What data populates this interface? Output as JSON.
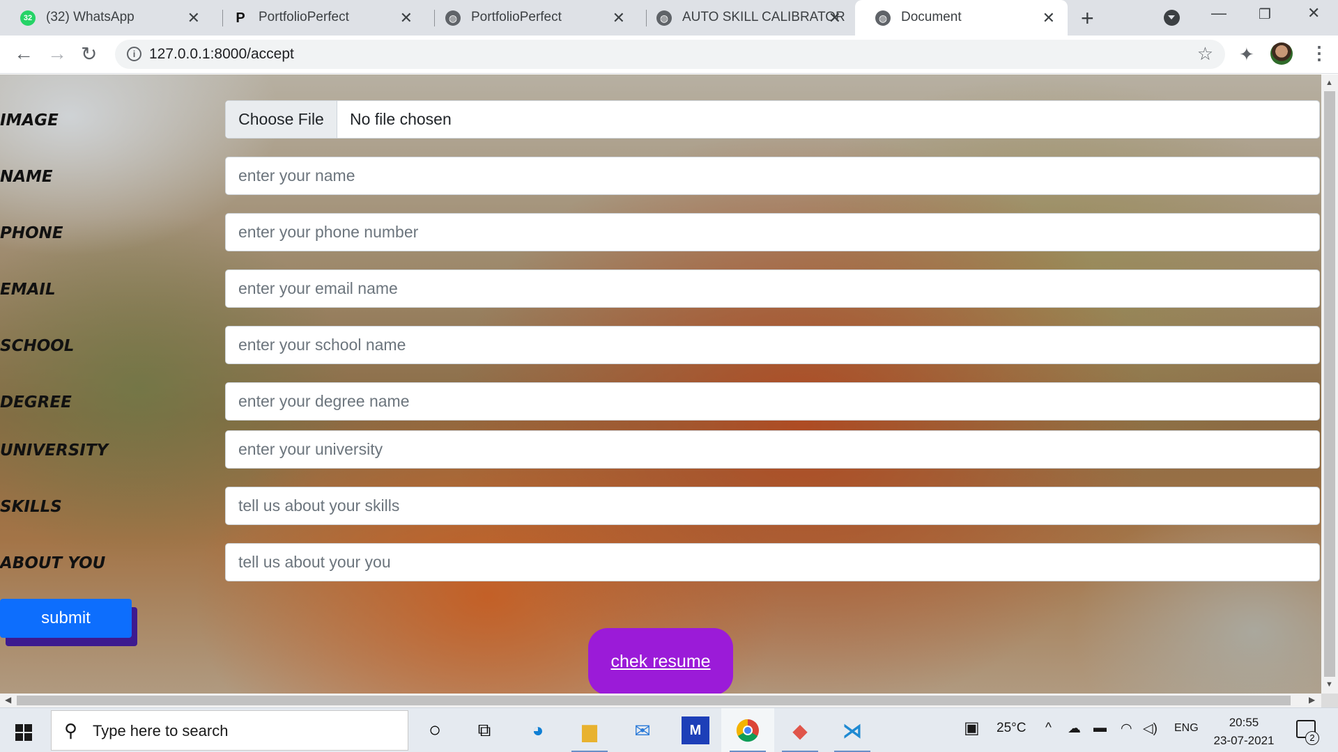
{
  "browser": {
    "tabs": [
      {
        "title": "(32) WhatsApp",
        "badge": "32"
      },
      {
        "title": "PortfolioPerfect"
      },
      {
        "title": "PortfolioPerfect"
      },
      {
        "title": "AUTO SKILL CALIBRATOR"
      },
      {
        "title": "Document"
      }
    ],
    "active_tab": 4,
    "url": "127.0.0.1:8000/accept"
  },
  "form": {
    "image_label": "IMAGE",
    "file_button": "Choose File",
    "file_status": "No file chosen",
    "fields": [
      {
        "label": "NAME",
        "placeholder": "enter your name"
      },
      {
        "label": "PHONE",
        "placeholder": "enter your phone number"
      },
      {
        "label": "EMAIL",
        "placeholder": "enter your email name"
      },
      {
        "label": "SCHOOL",
        "placeholder": "enter your school name"
      },
      {
        "label": "DEGREE",
        "placeholder": "enter your degree name"
      },
      {
        "label": "UNIVERSITY",
        "placeholder": "enter your university"
      },
      {
        "label": "SKILLS",
        "placeholder": "tell us about your skills"
      },
      {
        "label": "ABOUT YOU",
        "placeholder": "tell us about your you"
      }
    ],
    "submit_label": "submit",
    "resume_link": "chek resume"
  },
  "taskbar": {
    "search_placeholder": "Type here to search",
    "weather": "25°C",
    "language": "ENG",
    "time": "20:55",
    "date": "23-07-2021",
    "notification_count": "2"
  },
  "colors": {
    "submit": "#0d6efd",
    "resume": "#9b1bd8",
    "whatsapp": "#25d366"
  }
}
